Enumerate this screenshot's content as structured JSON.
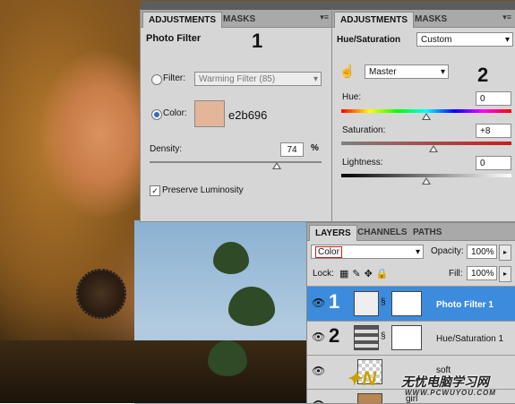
{
  "adjustments_left": {
    "tabs": [
      "ADJUSTMENTS",
      "MASKS"
    ],
    "title": "Photo Filter",
    "step_number": "1",
    "filter_label": "Filter:",
    "filter_value": "Warming Filter (85)",
    "color_label": "Color:",
    "color_swatch": "#e2b696",
    "color_hex_text": "e2b696",
    "density_label": "Density:",
    "density_value": "74",
    "density_unit": "%",
    "density_level": 74,
    "preserve_label": "Preserve Luminosity",
    "preserve_checked": true
  },
  "adjustments_right": {
    "tabs": [
      "ADJUSTMENTS",
      "MASKS"
    ],
    "title": "Hue/Saturation",
    "preset_value": "Custom",
    "channel_value": "Master",
    "step_number": "2",
    "hue_label": "Hue:",
    "hue_value": "0",
    "saturation_label": "Saturation:",
    "saturation_value": "+8",
    "lightness_label": "Lightness:",
    "lightness_value": "0"
  },
  "layers": {
    "tabs": [
      "LAYERS",
      "CHANNELS",
      "PATHS"
    ],
    "blend_mode": "Color",
    "opacity_label": "Opacity:",
    "opacity_value": "100%",
    "lock_label": "Lock:",
    "fill_label": "Fill:",
    "fill_value": "100%",
    "rows": [
      {
        "number": "1",
        "name": "Photo Filter 1",
        "selected": true
      },
      {
        "number": "2",
        "name": "Hue/Saturation 1",
        "selected": false
      },
      {
        "number": "",
        "name": "soft",
        "selected": false
      },
      {
        "number": "",
        "name": "girl",
        "selected": false
      }
    ]
  },
  "watermark": {
    "text": "无忧电脑学习网",
    "url": "WWW.PCWUYOU.COM"
  },
  "colors": {
    "selected_row": "#3d8bdc",
    "accent_red": "#c81e1e"
  }
}
